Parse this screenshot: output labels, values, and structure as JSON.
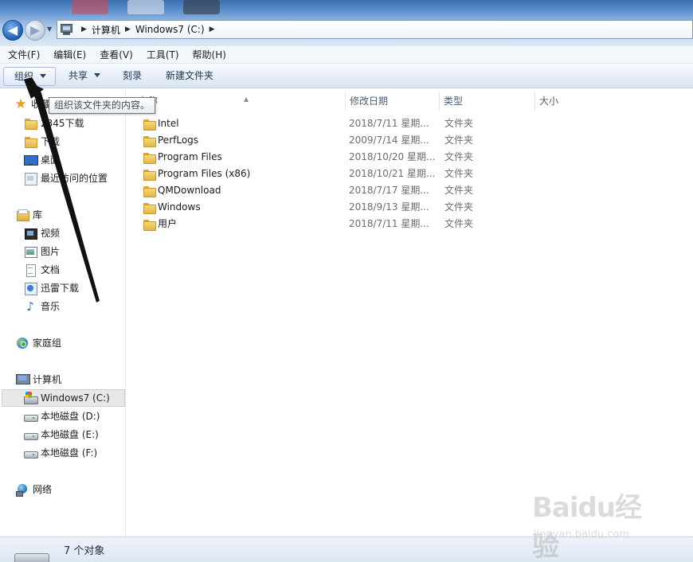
{
  "address_bar": {
    "back_icon": "back-arrow-icon",
    "forward_icon": "forward-arrow-icon",
    "breadcrumbs": [
      "计算机",
      "Windows7 (C:)"
    ],
    "separator": "▶"
  },
  "menu": {
    "items": [
      "文件(F)",
      "编辑(E)",
      "查看(V)",
      "工具(T)",
      "帮助(H)"
    ]
  },
  "toolbar": {
    "organize_label": "组织",
    "share_label": "共享",
    "burn_label": "刻录",
    "new_folder_label": "新建文件夹"
  },
  "tooltip": {
    "text": "组织该文件夹的内容。"
  },
  "nav": {
    "favorites": [
      {
        "label": "收藏夹",
        "icon": "star-icon"
      },
      {
        "label": "2345下载",
        "icon": "folder-icon"
      },
      {
        "label": "下载",
        "icon": "downloads-folder-icon"
      },
      {
        "label": "桌面",
        "icon": "desktop-icon"
      },
      {
        "label": "最近访问的位置",
        "icon": "recent-places-icon"
      }
    ],
    "libraries": [
      {
        "label": "库",
        "icon": "library-icon"
      },
      {
        "label": "视频",
        "icon": "video-icon"
      },
      {
        "label": "图片",
        "icon": "pictures-icon"
      },
      {
        "label": "文档",
        "icon": "documents-icon"
      },
      {
        "label": "迅雷下载",
        "icon": "thunder-download-icon"
      },
      {
        "label": "音乐",
        "icon": "music-icon"
      }
    ],
    "homegroup": {
      "label": "家庭组",
      "icon": "homegroup-icon"
    },
    "computer": [
      {
        "label": "计算机",
        "icon": "computer-icon"
      },
      {
        "label": "Windows7 (C:)",
        "icon": "windows-drive-icon"
      },
      {
        "label": "本地磁盘 (D:)",
        "icon": "local-disk-icon"
      },
      {
        "label": "本地磁盘 (E:)",
        "icon": "local-disk-icon"
      },
      {
        "label": "本地磁盘 (F:)",
        "icon": "local-disk-icon"
      }
    ],
    "network": {
      "label": "网络",
      "icon": "network-icon"
    }
  },
  "files": {
    "columns": [
      "名称",
      "修改日期",
      "类型",
      "大小"
    ],
    "rows": [
      {
        "name": "Intel",
        "date": "2018/7/11 星期...",
        "type": "文件夹"
      },
      {
        "name": "PerfLogs",
        "date": "2009/7/14 星期...",
        "type": "文件夹"
      },
      {
        "name": "Program Files",
        "date": "2018/10/20 星期...",
        "type": "文件夹"
      },
      {
        "name": "Program Files (x86)",
        "date": "2018/10/21 星期...",
        "type": "文件夹"
      },
      {
        "name": "QMDownload",
        "date": "2018/7/17 星期...",
        "type": "文件夹"
      },
      {
        "name": "Windows",
        "date": "2018/9/13 星期...",
        "type": "文件夹"
      },
      {
        "name": "用户",
        "date": "2018/7/11 星期...",
        "type": "文件夹"
      }
    ]
  },
  "status": {
    "count_text": "7 个对象"
  },
  "watermark": {
    "logo": "Baidu经验",
    "url": "jingyan.baidu.com"
  },
  "colors": {
    "selection": "#e8e8e8",
    "header_text": "#4c607a",
    "annotation_arrow": "#111111"
  }
}
